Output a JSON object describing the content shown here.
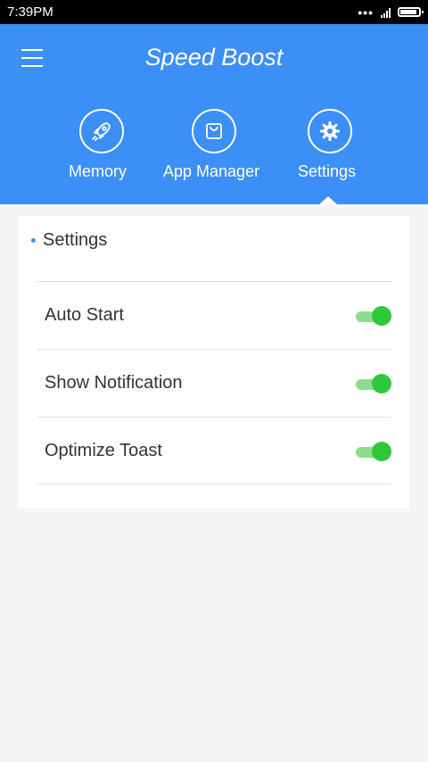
{
  "status_bar": {
    "time": "7:39PM",
    "dots": "•••"
  },
  "header": {
    "title": "Speed Boost",
    "tabs": [
      {
        "label": "Memory",
        "icon": "rocket-icon"
      },
      {
        "label": "App Manager",
        "icon": "shopping-bag-icon"
      },
      {
        "label": "Settings",
        "icon": "gear-icon"
      }
    ],
    "active_tab": "Settings",
    "accent_color": "#3c8ff6"
  },
  "settings": {
    "section_title": "Settings",
    "items": [
      {
        "label": "Auto Start",
        "enabled": true
      },
      {
        "label": "Show Notification",
        "enabled": true
      },
      {
        "label": "Optimize Toast",
        "enabled": true
      }
    ],
    "toggle_color": "#2fc83b"
  }
}
